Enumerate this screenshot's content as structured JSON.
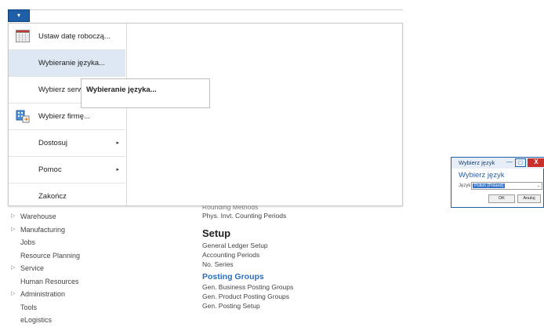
{
  "app_button": {
    "arrow": "▾"
  },
  "menu": {
    "items": [
      {
        "label": "Ustaw datę roboczą...",
        "icon": "calendar-icon"
      },
      {
        "label": "Wybieranie języka...",
        "highlighted": true
      },
      {
        "label": "Wybierz serwer"
      },
      {
        "label": "Wybierz firmę...",
        "icon": "select-company-icon"
      },
      {
        "label": "Dostosuj",
        "submenu": true
      },
      {
        "label": "Pomoc",
        "submenu": true
      },
      {
        "label": "Zakończ"
      }
    ],
    "submenu_arrow": "▸"
  },
  "tooltip": {
    "text": "Wybieranie języka..."
  },
  "nav": {
    "items": [
      {
        "label": "Warehouse",
        "expandable": true
      },
      {
        "label": "Manufacturing",
        "expandable": true
      },
      {
        "label": "Jobs"
      },
      {
        "label": "Resource Planning"
      },
      {
        "label": "Service",
        "expandable": true
      },
      {
        "label": "Human Resources"
      },
      {
        "label": "Administration",
        "expandable": true
      },
      {
        "label": "Tools"
      },
      {
        "label": "eLogistics"
      }
    ],
    "expand_glyph": "▷"
  },
  "content": {
    "clipped_line": "Rounding Methods",
    "line2": "Phys. Invt. Counting Periods",
    "setup_heading": "Setup",
    "setup_items": [
      "General Ledger Setup",
      "Accounting Periods",
      "No. Series"
    ],
    "posting_heading": "Posting Groups",
    "posting_items": [
      "Gen. Business Posting Groups",
      "Gen. Product Posting Groups",
      "Gen. Posting Setup"
    ]
  },
  "dialog": {
    "title": "Wybierz język",
    "heading": "Wybierz język",
    "label": "Język:",
    "selected_value": "Polish (Poland)",
    "ok": "OK",
    "cancel": "Anuluj",
    "min_glyph": "—",
    "max_glyph": "□",
    "close_glyph": "X"
  },
  "colors": {
    "accent": "#1f5fa8",
    "highlight": "#dde8f4",
    "link_heading": "#2a6ebb",
    "close": "#c9302c"
  }
}
